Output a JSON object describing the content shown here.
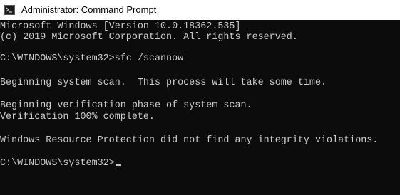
{
  "window": {
    "title": "Administrator: Command Prompt",
    "icon": "cmd-icon"
  },
  "console": {
    "lines": [
      "Microsoft Windows [Version 10.0.18362.535]",
      "(c) 2019 Microsoft Corporation. All rights reserved.",
      "",
      "C:\\WINDOWS\\system32>sfc /scannow",
      "",
      "Beginning system scan.  This process will take some time.",
      "",
      "Beginning verification phase of system scan.",
      "Verification 100% complete.",
      "",
      "Windows Resource Protection did not find any integrity violations.",
      "",
      "C:\\WINDOWS\\system32>"
    ]
  },
  "colors": {
    "background": "#0c0c0c",
    "text": "#cccccc",
    "titlebar": "#ffffff"
  }
}
